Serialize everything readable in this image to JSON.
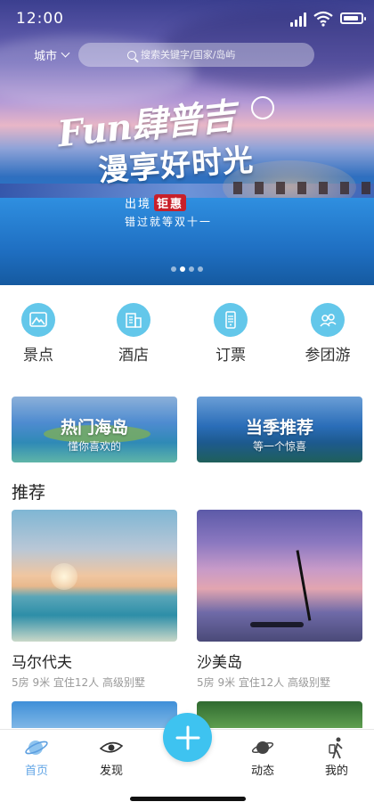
{
  "status_bar": {
    "time": "12:00"
  },
  "header": {
    "city_label": "城市",
    "search_placeholder": "搜索关键字/国家/岛屿"
  },
  "banner": {
    "line1": "Fun肆普吉",
    "line2": "漫享好时光",
    "line3_pre": "出境",
    "line3_seal": "钜惠",
    "line4": "错过就等双十一",
    "slides": 4,
    "active_slide": 2
  },
  "categories": [
    {
      "label": "景点",
      "icon": "mountain-icon"
    },
    {
      "label": "酒店",
      "icon": "hotel-icon"
    },
    {
      "label": "订票",
      "icon": "ticket-icon"
    },
    {
      "label": "参团游",
      "icon": "group-icon"
    }
  ],
  "promos": [
    {
      "title": "热门海岛",
      "subtitle": "懂你喜欢的"
    },
    {
      "title": "当季推荐",
      "subtitle": "等一个惊喜"
    }
  ],
  "recommend": {
    "heading": "推荐",
    "items": [
      {
        "title": "马尔代夫",
        "meta": "5房 9米 宜住12人 高级别墅"
      },
      {
        "title": "沙美岛",
        "meta": "5房 9米 宜住12人 高级别墅"
      }
    ]
  },
  "tabbar": {
    "items": [
      {
        "label": "首页",
        "icon": "globe-icon",
        "active": true
      },
      {
        "label": "发现",
        "icon": "eye-icon",
        "active": false
      },
      {
        "label": "动态",
        "icon": "planet-icon",
        "active": false
      },
      {
        "label": "我的",
        "icon": "traveler-icon",
        "active": false
      }
    ],
    "fab_icon": "plus-icon"
  },
  "colors": {
    "accent": "#3ec3f0",
    "icon_bg": "#63c7ea",
    "active_tab": "#63a6e6"
  }
}
